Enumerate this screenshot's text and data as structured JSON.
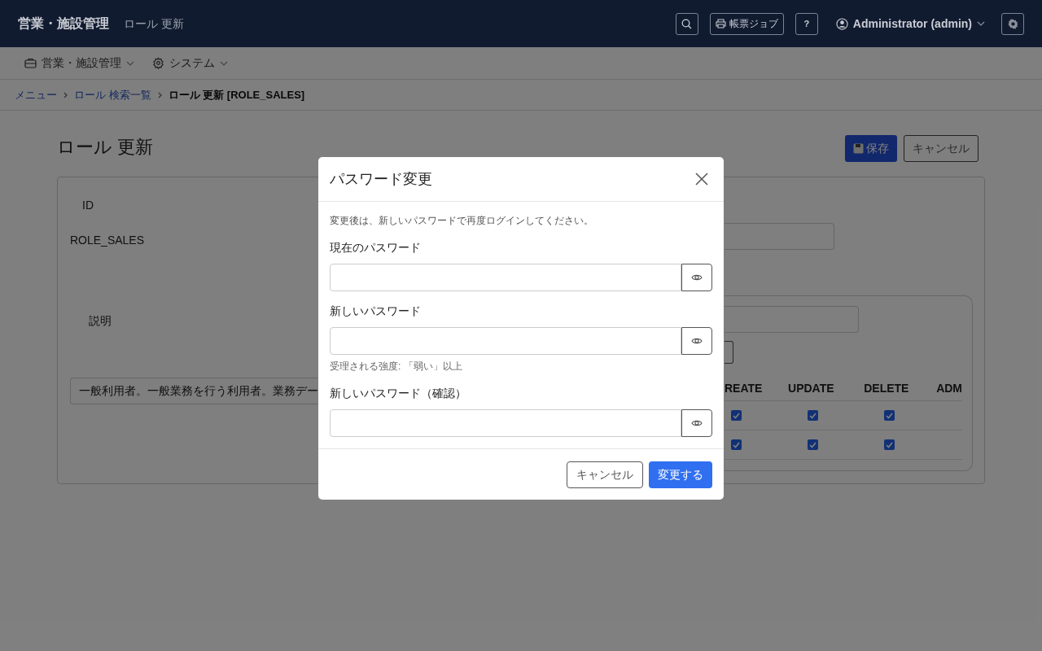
{
  "header": {
    "app_title": "営業・施設管理",
    "page_title": "ロール 更新",
    "jobs_button": "帳票ジョブ",
    "help_button": "?",
    "user": "Administrator (admin)"
  },
  "nav": [
    {
      "label": "営業・施設管理",
      "kind": "briefcase"
    },
    {
      "label": "システム",
      "kind": "gear"
    }
  ],
  "breadcrumb": [
    {
      "label": "メニュー",
      "kind": "link"
    },
    {
      "label": "ロール 検索一覧",
      "kind": "link"
    },
    {
      "label": "ロール 更新 [ROLE_SALES]",
      "kind": "current"
    }
  ],
  "page": {
    "title": "ロール 更新",
    "save_button": "保存",
    "cancel_button": "キャンセル"
  },
  "form": {
    "id_label": "ID",
    "id_value": "ROLE_SALES",
    "description_label": "説明",
    "description_value": "一般利用者。一般業務を行う利用者。業務デー"
  },
  "permissions": {
    "columns": [
      "REATE",
      "UPDATE",
      "DELETE",
      "ADM"
    ],
    "rows": [
      {
        "checks": [
          true,
          true,
          true
        ]
      },
      {
        "checks": [
          true,
          true,
          true
        ]
      }
    ]
  },
  "modal": {
    "title": "パスワード変更",
    "note": "変更後は、新しいパスワードで再度ログインしてください。",
    "fields": [
      {
        "label": "現在のパスワード"
      },
      {
        "label": "新しいパスワード",
        "hint": "受理される強度: 「弱い」以上"
      },
      {
        "label": "新しいパスワード（確認）"
      }
    ],
    "cancel_button": "キャンセル",
    "submit_button": "変更する"
  }
}
